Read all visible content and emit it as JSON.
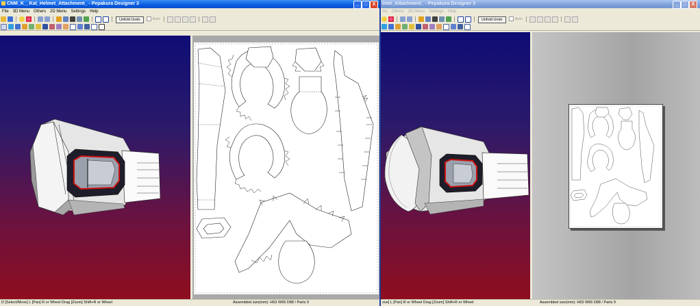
{
  "left_window": {
    "title": "CNM_K__Kat_Helmet_Attachment_ - Pepakura Designer 3",
    "menu": [
      "File",
      "3D Menu",
      "Others",
      "2D Menu",
      "Settings",
      "Help"
    ],
    "unfold_undo": "Unfold Undo",
    "auto_label": "Auto",
    "status_left": "D [Select/Move] L [Pan] R or Wheel Drag [Zoom] Shift+R or Wheel",
    "status_right": "Assembled size(mm): H63 W65 D88 / Parts 9"
  },
  "right_window": {
    "title": "lmet_Attachment_ - Pepakura Designer 3",
    "menu": [
      "nu",
      "Others",
      "2D Menu",
      "Settings",
      "Help"
    ],
    "unfold_undo": "Unfold Undo",
    "auto_label": "Auto",
    "status_left": "ove] L [Pan] R or Wheel Drag [Zoom] Shift+R or Wheel",
    "status_right": "Assembled size(mm): H63 W65 D88 / Parts 9"
  },
  "window_controls": {
    "minimize": "_",
    "maximize": "□",
    "close": "X"
  },
  "colors": {
    "title_active": "#0a5ce0",
    "title_inactive": "#7d9fd8",
    "viewport_top": "#0e0d75",
    "viewport_bottom": "#8e0e1e",
    "visor_outline": "#cc1111"
  },
  "toolbar_icons": [
    "open-icon",
    "save-icon",
    "light-icon",
    "sphere-icon",
    "undo-icon",
    "redo-icon",
    "pen-icon",
    "rotate-icon",
    "anchor-icon",
    "split-icon",
    "join-icon",
    "window-icon",
    "window2-icon"
  ],
  "toolbar2_icons": [
    "pointer-icon",
    "edge-icon",
    "texture-icon",
    "fill-icon",
    "part-icon",
    "print-icon",
    "flap-icon",
    "scissor-icon",
    "glue-icon",
    "layout-icon",
    "number-icon",
    "image-icon",
    "table-icon",
    "grid-icon"
  ]
}
